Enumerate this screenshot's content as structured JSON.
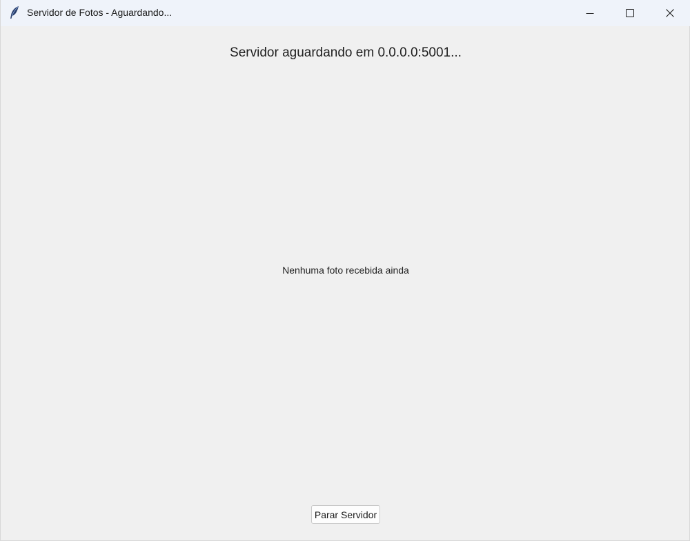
{
  "window": {
    "title": "Servidor de Fotos - Aguardando...",
    "app_icon": "feather-icon",
    "controls": [
      "minimize-icon",
      "maximize-icon",
      "close-icon"
    ]
  },
  "main": {
    "status_text": "Servidor aguardando em 0.0.0.0:5001...",
    "photo_placeholder": "Nenhuma foto recebida ainda",
    "stop_button_label": "Parar Servidor"
  }
}
